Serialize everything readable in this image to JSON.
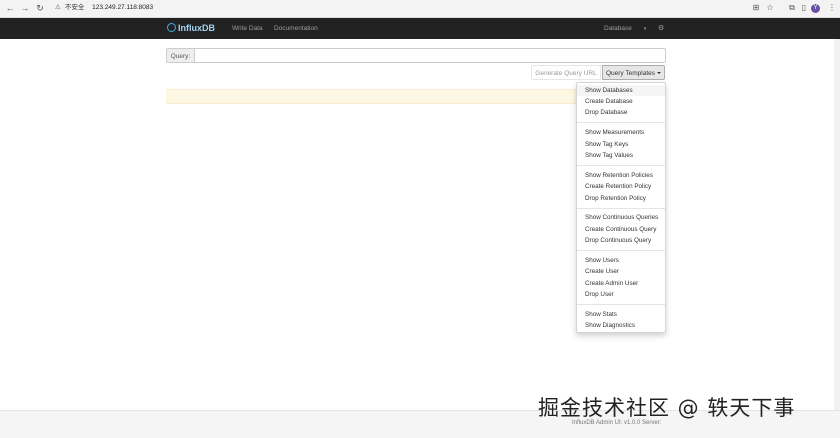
{
  "browser": {
    "security_label": "不安全",
    "url": "123.249.27.118:8083"
  },
  "navbar": {
    "brand": "InfluxDB",
    "links": [
      "Write Data",
      "Documentation"
    ],
    "database_label": "Database"
  },
  "query": {
    "label": "Query:",
    "value": "",
    "placeholder": ""
  },
  "buttons": {
    "generate_url": "Generate Query URL",
    "templates": "Query Templates"
  },
  "dropdown": {
    "groups": [
      [
        "Show Databases",
        "Create Database",
        "Drop Database"
      ],
      [
        "Show Measurements",
        "Show Tag Keys",
        "Show Tag Values"
      ],
      [
        "Show Retention Policies",
        "Create Retention Policy",
        "Drop Retention Policy"
      ],
      [
        "Show Continuous Queries",
        "Create Continuous Query",
        "Drop Continuous Query"
      ],
      [
        "Show Users",
        "Create User",
        "Create Admin User",
        "Drop User"
      ],
      [
        "Show Stats",
        "Show Diagnostics"
      ]
    ]
  },
  "footer": {
    "text": "InfluxDB Admin UI: v1.0.0 Server:"
  },
  "watermark": "掘金技术社区 @ 轶天下事",
  "icons": {
    "back": "arrow-left-icon",
    "forward": "arrow-right-icon",
    "reload": "reload-icon",
    "warning": "warning-icon",
    "translate": "translate-icon",
    "star": "star-icon",
    "extensions": "puzzle-icon",
    "settings": "gear-icon"
  },
  "colors": {
    "navbar_bg": "#222222",
    "brand": "#9fd5f5",
    "alert_bg": "#fcf8e3"
  }
}
